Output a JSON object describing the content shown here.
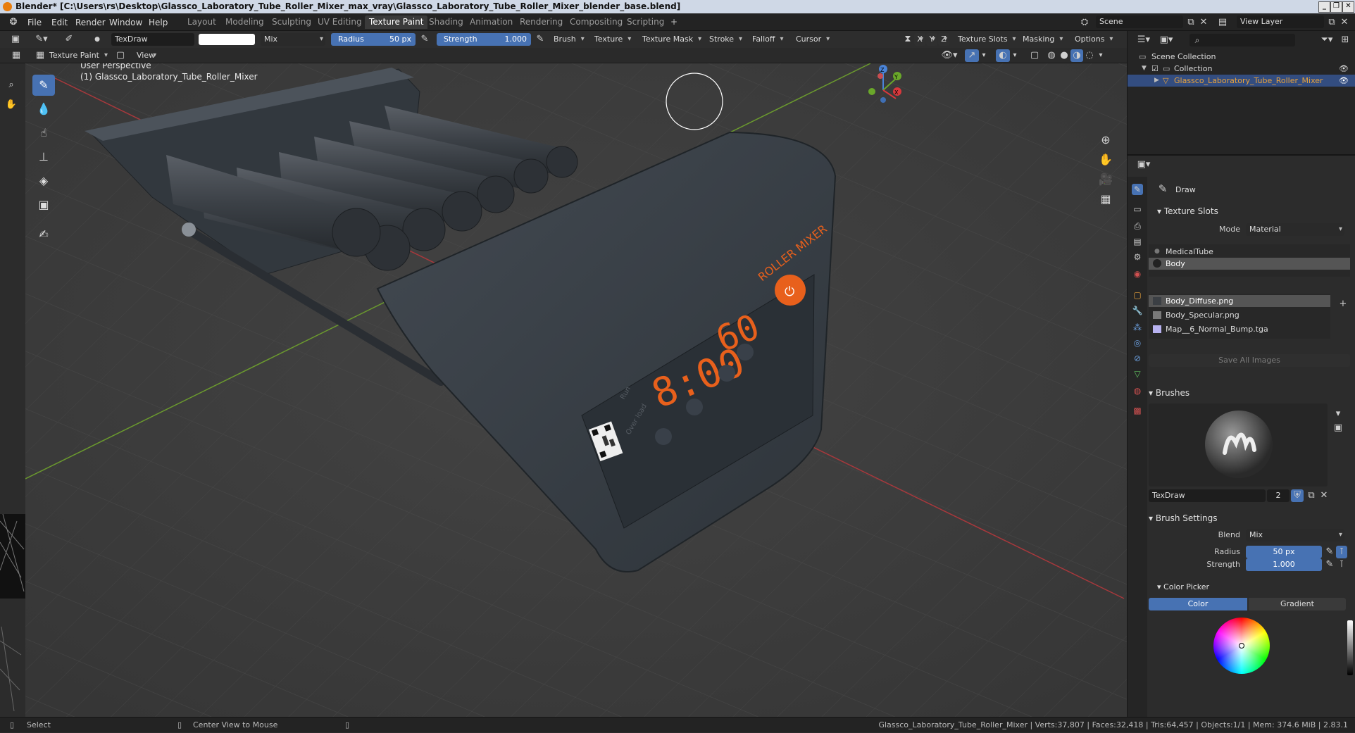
{
  "window": {
    "title": "Blender* [C:\\Users\\rs\\Desktop\\Glassco_Laboratory_Tube_Roller_Mixer_max_vray\\Glassco_Laboratory_Tube_Roller_Mixer_blender_base.blend]",
    "controls": [
      "_",
      "❐",
      "✕"
    ]
  },
  "menubar": {
    "menus": [
      "File",
      "Edit",
      "Render",
      "Window",
      "Help"
    ],
    "workspaces": [
      "Layout",
      "Modeling",
      "Sculpting",
      "UV Editing",
      "Texture Paint",
      "Shading",
      "Animation",
      "Rendering",
      "Compositing",
      "Scripting"
    ],
    "active_workspace": "Texture Paint",
    "add_tab": "+",
    "scene": "Scene",
    "view_layer": "View Layer"
  },
  "tool_header": {
    "brush_name": "TexDraw",
    "blend_mode": "Mix",
    "radius_label": "Radius",
    "radius_value": "50 px",
    "strength_label": "Strength",
    "strength_value": "1.000",
    "strength_fraction": 1.0,
    "menus": [
      "Brush",
      "Texture",
      "Texture Mask",
      "Stroke",
      "Falloff",
      "Cursor"
    ],
    "axis": [
      "X",
      "Y",
      "Z"
    ],
    "right_menus": [
      "Texture Slots",
      "Masking",
      "Options"
    ]
  },
  "header2": {
    "mode": "Texture Paint",
    "view_menu": "View"
  },
  "viewport": {
    "perspective": "User Perspective",
    "object": "(1) Glassco_Laboratory_Tube_Roller_Mixer",
    "display_time": "8:00",
    "display_speed": "60",
    "brand": "ROLLER MIXER",
    "run_label": "Run",
    "overload_label": "Over load",
    "gizmo_axes": [
      "Z",
      "Y",
      "X"
    ]
  },
  "outliner": {
    "scene_collection": "Scene Collection",
    "collection": "Collection",
    "object": "Glassco_Laboratory_Tube_Roller_Mixer"
  },
  "properties": {
    "tool_name": "Draw",
    "texture_slots_title": "Texture Slots",
    "mode_label": "Mode",
    "mode_value": "Material",
    "materials": [
      "MedicalTube",
      "Body"
    ],
    "selected_material": "Body",
    "images": [
      {
        "name": "Body_Diffuse.png",
        "color": "#3b3f44"
      },
      {
        "name": "Body_Specular.png",
        "color": "#7a7a7a"
      },
      {
        "name": "Map__6_Normal_Bump.tga",
        "color": "#b8b2f0"
      }
    ],
    "save_all_images": "Save All Images",
    "brushes_title": "Brushes",
    "brush_name": "TexDraw",
    "brush_users": "2",
    "brush_settings_title": "Brush Settings",
    "blend_label": "Blend",
    "blend_value": "Mix",
    "radius_label": "Radius",
    "radius_value": "50 px",
    "strength_label": "Strength",
    "strength_value": "1.000",
    "color_picker_title": "Color Picker",
    "color_tab": "Color",
    "gradient_tab": "Gradient"
  },
  "statusbar": {
    "select": "Select",
    "center_view": "Center View to Mouse",
    "stats": "Glassco_Laboratory_Tube_Roller_Mixer | Verts:37,807 | Faces:32,418 | Tris:64,457 | Objects:1/1 | Mem: 374.6 MiB | 2.83.1"
  },
  "colors": {
    "accent": "#4772b3",
    "orange": "#e8601c",
    "body": "#3a4148"
  }
}
